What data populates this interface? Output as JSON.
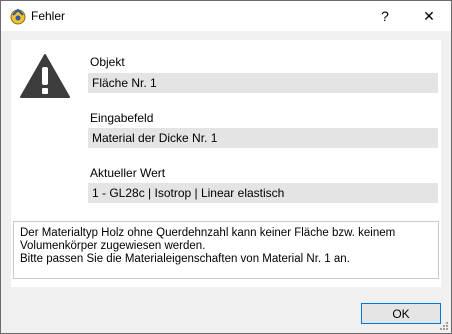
{
  "window": {
    "title": "Fehler",
    "help_glyph": "?",
    "close_glyph": "✕"
  },
  "icons": {
    "app": "rfem-app-icon",
    "warning": "warning-triangle-icon"
  },
  "fields": [
    {
      "label": "Objekt",
      "value": "Fläche Nr. 1"
    },
    {
      "label": "Eingabefeld",
      "value": "Material der Dicke Nr. 1"
    },
    {
      "label": "Aktueller Wert",
      "value": "1 - GL28c | Isotrop | Linear elastisch"
    }
  ],
  "message": {
    "lines": [
      "Der Materialtyp Holz ohne Querdehnzahl kann keiner Fläche bzw. keinem",
      "Volumenkörper zugewiesen werden.",
      "Bitte passen Sie die Materialeigenschaften von Material Nr. 1 an."
    ]
  },
  "buttons": {
    "ok": "OK"
  },
  "colors": {
    "accent": "#0078d7",
    "field_bg": "#e4e4e4",
    "dialog_bg": "#f0f0f0"
  }
}
